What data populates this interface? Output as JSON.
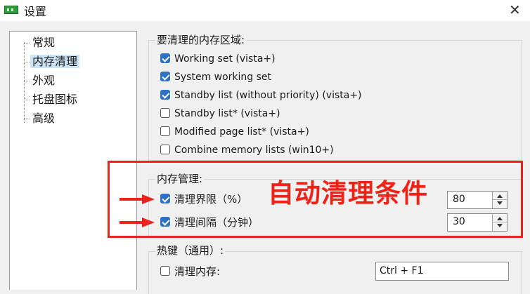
{
  "window": {
    "title": "设置",
    "close_glyph": "✕"
  },
  "sidebar": {
    "items": [
      {
        "label": "常规",
        "selected": false
      },
      {
        "label": "内存清理",
        "selected": true
      },
      {
        "label": "外观",
        "selected": false
      },
      {
        "label": "托盘图标",
        "selected": false
      },
      {
        "label": "高级",
        "selected": false
      }
    ]
  },
  "regions": {
    "title": "要清理的内存区域:",
    "options": [
      {
        "label": "Working set (vista+)",
        "checked": true
      },
      {
        "label": "System working set",
        "checked": true
      },
      {
        "label": "Standby list (without priority) (vista+)",
        "checked": true
      },
      {
        "label": "Standby list* (vista+)",
        "checked": false
      },
      {
        "label": "Modified page list* (vista+)",
        "checked": false
      },
      {
        "label": "Combine memory lists (win10+)",
        "checked": false
      }
    ]
  },
  "memory": {
    "title": "内存管理:",
    "limit": {
      "label": "清理界限（%）",
      "checked": true,
      "value": "80"
    },
    "interval": {
      "label": "清理间隔（分钟）",
      "checked": true,
      "value": "30"
    }
  },
  "hotkeys": {
    "title": "热键（通用）:",
    "clean": {
      "label": "清理内存:",
      "checked": false,
      "value": "Ctrl + F1"
    }
  },
  "annotation": {
    "text": "自动清理条件",
    "color": "#ee2318"
  },
  "colors": {
    "checkbox_checked": "#2f72c4",
    "selection": "#cce4f7",
    "annotation_red": "#e8241c"
  }
}
